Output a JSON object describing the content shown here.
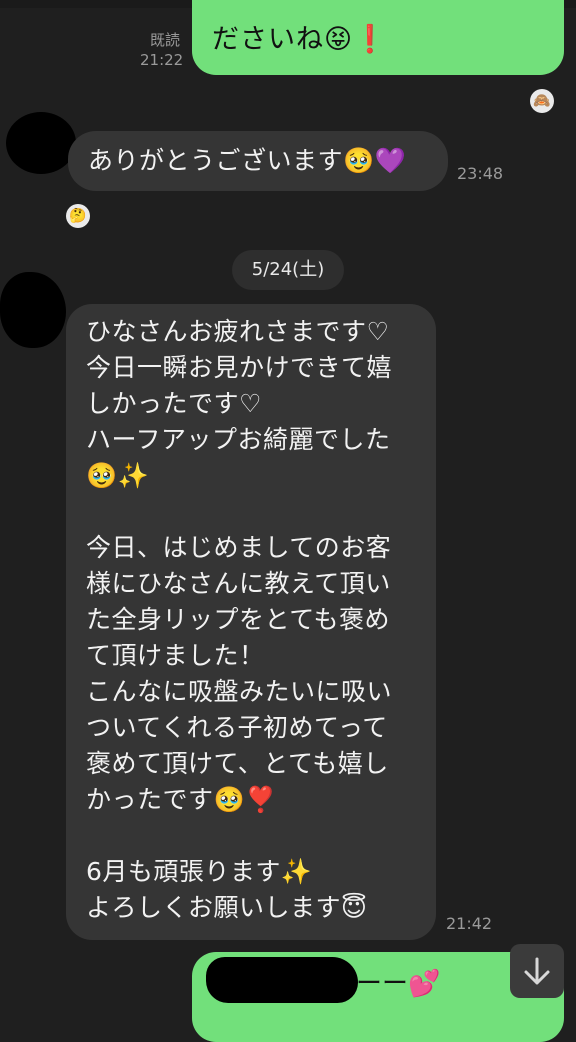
{
  "top_bubble": {
    "text": "ださいね",
    "emoji_face": "😝",
    "emoji_mark": "❗",
    "read_label": "既読",
    "time": "21:22"
  },
  "reaction_right": {
    "icon": "sticker-face-icon",
    "glyph": "🙈"
  },
  "msg_thanks": {
    "text": "ありがとうございます🥹💜",
    "time": "23:48"
  },
  "reaction_left": {
    "icon": "thinking-face-icon",
    "glyph": "🤔"
  },
  "date_chip": "5/24(土)",
  "msg_long": {
    "lines": [
      "ひなさんお疲れさまです♡",
      "今日一瞬お見かけできて嬉",
      "しかったです♡",
      "ハーフアップお綺麗でした",
      "🥹✨",
      "",
      "今日、はじめましてのお客",
      "様にひなさんに教えて頂い",
      "た全身リップをとても褒め",
      "て頂けました！",
      "こんなに吸盤みたいに吸い",
      "ついてくれる子初めてって",
      "褒めて頂けて、とても嬉し",
      "かったです🥹❣️",
      "",
      "6月も頑張ります✨",
      "よろしくお願いします😇"
    ],
    "time": "21:42"
  },
  "bottom_bubble": {
    "text": "ーー",
    "emoji": "💕"
  },
  "scroll_down_icon": "arrow-down-icon",
  "colors": {
    "background": "#1f1f1f",
    "outgoing_bubble": "#72e07b",
    "incoming_bubble": "#353535"
  }
}
